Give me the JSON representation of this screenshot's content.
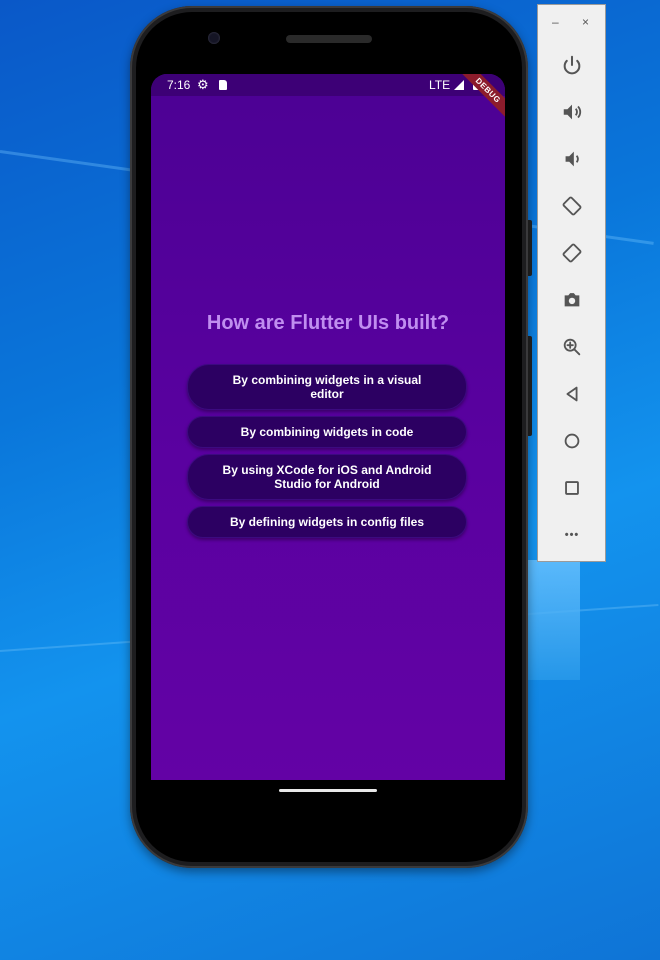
{
  "status_bar": {
    "time": "7:16",
    "network": "LTE"
  },
  "debug_banner": "DEBUG",
  "quiz": {
    "question": "How are Flutter UIs built?",
    "answers": [
      "By combining widgets in a visual editor",
      "By combining widgets in code",
      "By using XCode for iOS and Android Studio for Android",
      "By defining widgets in config files"
    ]
  },
  "emulator_toolbar": {
    "minimize_label": "–",
    "close_label": "×",
    "more_label": "•••"
  },
  "colors": {
    "screen_top": "#4c0194",
    "screen_bottom": "#6302a5",
    "button_bg": "#2c0062",
    "question_text": "#c08ef0"
  }
}
